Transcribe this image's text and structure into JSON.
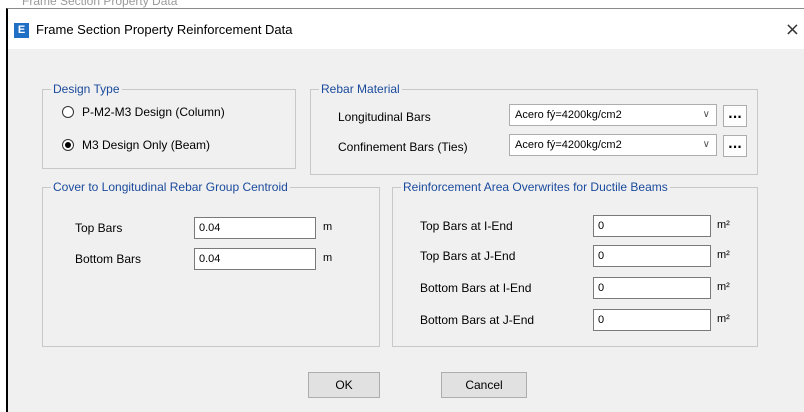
{
  "background_title": "Frame Section Property Data",
  "window": {
    "icon_letter": "E",
    "title": "Frame Section Property Reinforcement Data",
    "close_glyph": "×"
  },
  "design_type": {
    "legend": "Design Type",
    "options": [
      {
        "label": "P-M2-M3 Design  (Column)",
        "checked": false
      },
      {
        "label": "M3 Design Only  (Beam)",
        "checked": true
      }
    ]
  },
  "rebar_material": {
    "legend": "Rebar Material",
    "longitudinal": {
      "label": "Longitudinal Bars",
      "value": "Acero fý=4200kg/cm2"
    },
    "confinement": {
      "label": "Confinement Bars (Ties)",
      "value": "Acero fý=4200kg/cm2"
    },
    "more_label": "...",
    "chevron_glyph": "∨"
  },
  "cover": {
    "legend": "Cover to Longitudinal Rebar Group Centroid",
    "top": {
      "label": "Top Bars",
      "value": "0.04",
      "unit": "m"
    },
    "bottom": {
      "label": "Bottom  Bars",
      "value": "0.04",
      "unit": "m"
    }
  },
  "reinforcement_area": {
    "legend": "Reinforcement Area Overwrites for Ductile Beams",
    "rows": [
      {
        "label": "Top Bars at I-End",
        "value": "0",
        "unit": "m²"
      },
      {
        "label": "Top Bars at J-End",
        "value": "0",
        "unit": "m²"
      },
      {
        "label": "Bottom Bars at I-End",
        "value": "0",
        "unit": "m²"
      },
      {
        "label": "Bottom Bars at J-End",
        "value": "0",
        "unit": "m²"
      }
    ]
  },
  "buttons": {
    "ok": "OK",
    "cancel": "Cancel"
  }
}
